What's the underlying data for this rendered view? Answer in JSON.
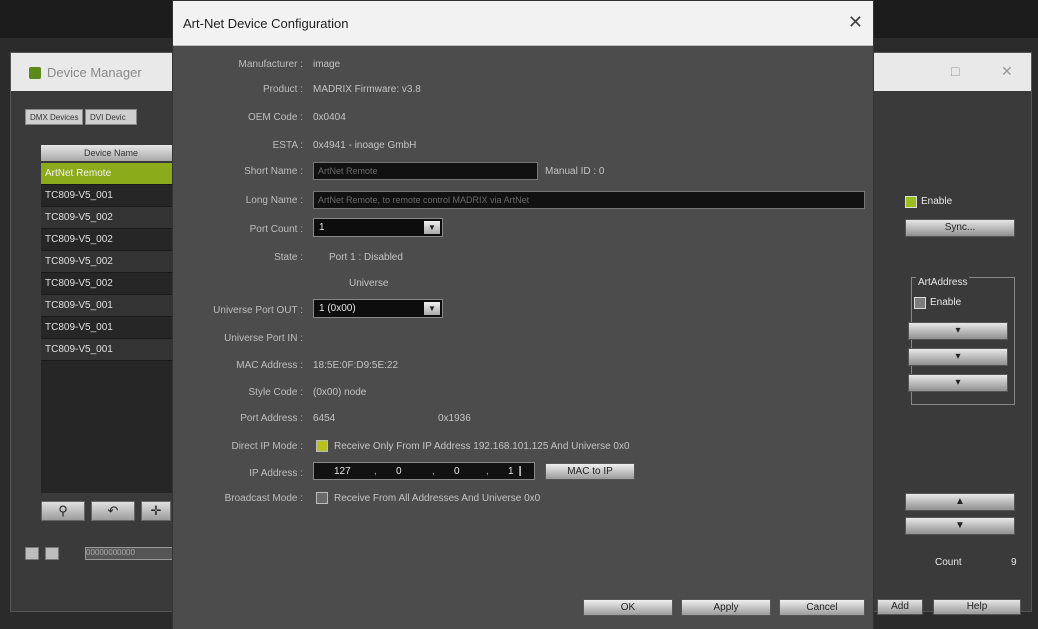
{
  "device_manager": {
    "title": "Device Manager",
    "minimize": "□",
    "close": "✕",
    "tabs": [
      "DMX Devices",
      "DVI Devic"
    ],
    "list_header": "Device Name",
    "devices": [
      {
        "name": "ArtNet Remote",
        "selected": true
      },
      {
        "name": "TC809-V5_001"
      },
      {
        "name": "TC809-V5_002"
      },
      {
        "name": "TC809-V5_002"
      },
      {
        "name": "TC809-V5_002"
      },
      {
        "name": "TC809-V5_002"
      },
      {
        "name": "TC809-V5_001"
      },
      {
        "name": "TC809-V5_001"
      },
      {
        "name": "TC809-V5_001"
      }
    ],
    "bottom_field": "00000000000",
    "right_panel": {
      "enable_label": "Enable",
      "sync_button": "Sync...",
      "group_title": "ArtAddress",
      "group_enable_label": "Enable",
      "count_label": "Count",
      "count_value": "9"
    },
    "footer_buttons": [
      "Add",
      "Help"
    ]
  },
  "dialog": {
    "title": "Art-Net Device Configuration",
    "close_glyph": "✕",
    "rows": {
      "manufacturer_label": "Manufacturer :",
      "manufacturer_value": "image",
      "product_label": "Product :",
      "product_value": "MADRIX   Firmware: v3.8",
      "oem_label": "OEM Code :",
      "oem_value": "0x0404",
      "esta_label": "ESTA :",
      "esta_value": "0x4941 - inoage GmbH",
      "short_name_label": "Short Name :",
      "short_name_value": "ArtNet Remote",
      "manual_id_label": "Manual ID : 0",
      "long_name_label": "Long Name :",
      "long_name_value": "ArtNet Remote, to remote control MADRIX via ArtNet",
      "port_count_label": "Port Count :",
      "port_count_value": "1",
      "state_label": "State :",
      "state_value": "Port 1 : Disabled",
      "universe_heading": "Universe",
      "universe_out_label": "Universe Port OUT :",
      "universe_out_value": "1    (0x00)",
      "universe_in_label": "Universe Port IN :",
      "mac_label": "MAC Address :",
      "mac_value": "18:5E:0F:D9:5E:22",
      "style_label": "Style Code :",
      "style_value": "(0x00) node",
      "port_address_label": "Port Address :",
      "port_address_value": "6454",
      "port_address_hex": "0x1936",
      "direct_ip_label": "Direct IP Mode :",
      "direct_ip_checked": true,
      "direct_ip_text": "Receive Only From IP Address 192.168.101.125 And Universe 0x0",
      "ip_label": "IP Address :",
      "ip_octets": [
        "127",
        "0",
        "0",
        "1"
      ],
      "mac_to_ip_button": "MAC to IP",
      "broadcast_label": "Broadcast Mode :",
      "broadcast_checked": false,
      "broadcast_text": "Receive From All Addresses And Universe 0x0"
    },
    "buttons": {
      "ok": "OK",
      "apply": "Apply",
      "cancel": "Cancel"
    }
  }
}
